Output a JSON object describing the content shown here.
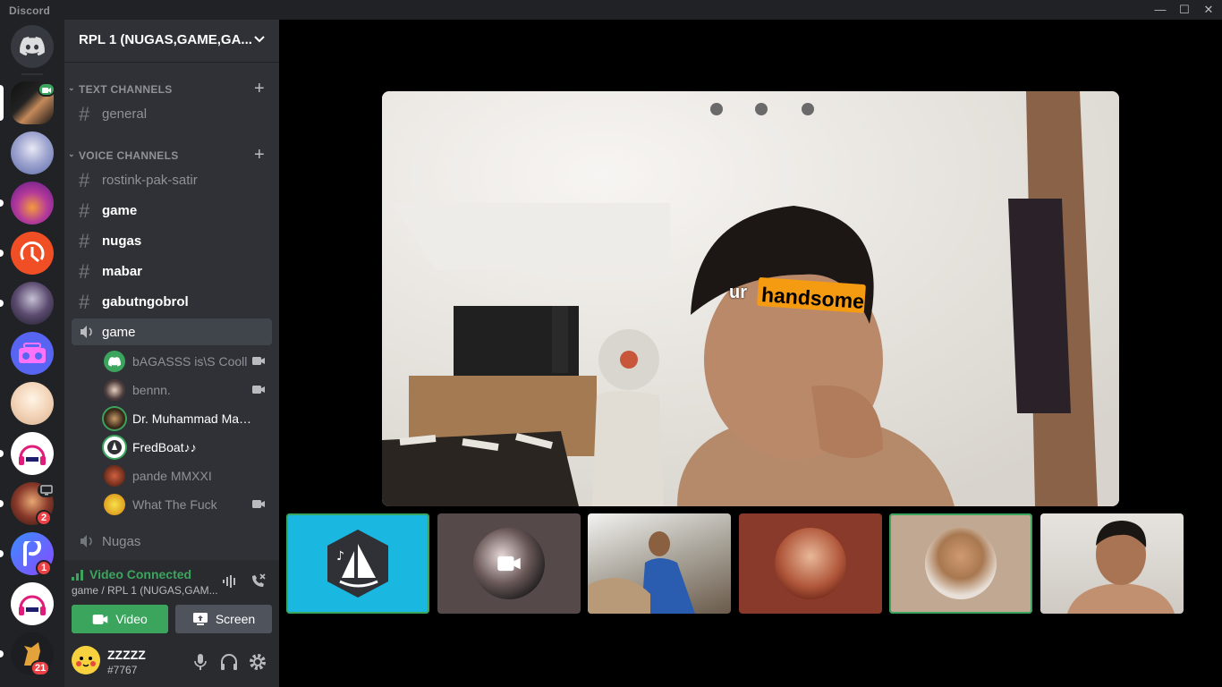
{
  "app": {
    "title": "Discord"
  },
  "window_controls": {
    "minimize": "—",
    "maximize": "☐",
    "close": "✕"
  },
  "rail": {
    "badges": [
      "2",
      "1",
      "21"
    ]
  },
  "guild": {
    "name": "RPL 1 (NUGAS,GAME,GA...",
    "categories": [
      {
        "label": "TEXT CHANNELS"
      },
      {
        "label": "VOICE CHANNELS"
      }
    ],
    "text_channels": [
      {
        "name": "general"
      }
    ],
    "voice_section": [
      {
        "name": "rostink-pak-satir"
      },
      {
        "name": "game"
      },
      {
        "name": "nugas"
      },
      {
        "name": "mabar"
      },
      {
        "name": "gabutngobrol"
      }
    ],
    "active_voice_channel": "game",
    "voice_users": [
      {
        "name": "bAGASSS is\\S Cooll",
        "camera": true
      },
      {
        "name": "bennn.",
        "camera": true
      },
      {
        "name": "Dr. Muhammad Made m...",
        "camera": false
      },
      {
        "name": "FredBoat♪♪",
        "camera": false
      },
      {
        "name": "pande MMXXI",
        "camera": false
      },
      {
        "name": "What The Fuck",
        "camera": true
      }
    ],
    "other_voice_channel": "Nugas"
  },
  "rtc": {
    "status": "Video Connected",
    "location": "game / RPL 1 (NUGAS,GAM...",
    "video_label": "Video",
    "screen_label": "Screen"
  },
  "user": {
    "name": "ZZZZZ",
    "tag": "#7767"
  },
  "video": {
    "caption_prefix": "ur",
    "caption_highlight": "handsome"
  },
  "colors": {
    "green": "#3ba55d",
    "blurple": "#5865f2",
    "red": "#ed4245",
    "fredboat": "#1ab8e1"
  }
}
